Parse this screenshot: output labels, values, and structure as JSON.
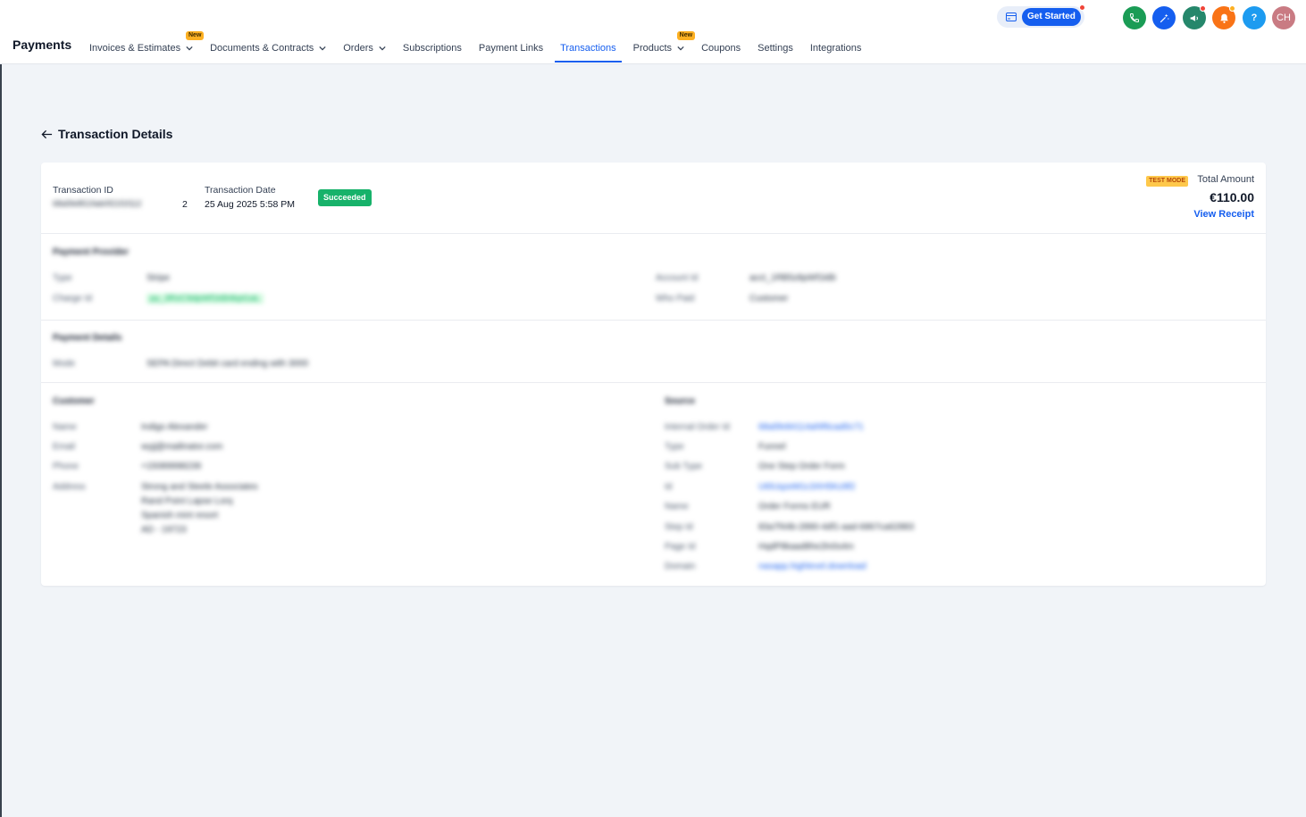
{
  "header": {
    "brand": "Payments",
    "nav": [
      {
        "label": "Invoices & Estimates",
        "dropdown": true,
        "badge": "New"
      },
      {
        "label": "Documents & Contracts",
        "dropdown": true
      },
      {
        "label": "Orders",
        "dropdown": true
      },
      {
        "label": "Subscriptions"
      },
      {
        "label": "Payment Links"
      },
      {
        "label": "Transactions",
        "active": true
      },
      {
        "label": "Products",
        "dropdown": true,
        "badge": "New"
      },
      {
        "label": "Coupons"
      },
      {
        "label": "Settings"
      },
      {
        "label": "Integrations"
      }
    ],
    "get_started": "Get Started",
    "help": "?",
    "avatar": "CH",
    "colors": {
      "accent": "#155eef",
      "phone": "#1a9c55",
      "magic": "#155eef",
      "megaphone": "#25876b",
      "bell": "#f97316",
      "help": "#1d9bf0",
      "avatar": "#c97b83"
    }
  },
  "page": {
    "title": "Transaction Details"
  },
  "transaction": {
    "id_label": "Transaction ID",
    "id_value": "68a5fe8519ab0f21f1f112",
    "id_last": "2",
    "date_label": "Transaction Date",
    "date_value": "25 Aug 2025 5:58 PM",
    "status": "Succeeded",
    "test_mode": "TEST MODE",
    "total_label": "Total Amount",
    "total_value": "€110.00",
    "view_receipt": "View Receipt"
  },
  "blurred": {
    "payment_provider": {
      "heading": "Payment Provider",
      "type_label": "Type",
      "type_value": "Stripe",
      "charge_label": "Charge Id",
      "charge_value": "py_3RzC9dpWf1kB4kpt1aL",
      "account_label": "Account Id",
      "account_value": "acct_1RB5z8pWf1kBi",
      "mode_label": "Who Paid",
      "mode_value": "Customer"
    },
    "payment_details": {
      "heading": "Payment Details",
      "mode_label": "Mode",
      "mode_value": "SEPA Direct Debit card ending with 3000"
    },
    "customer": {
      "heading": "Customer",
      "name_label": "Name",
      "name_value": "Indigo Alexander",
      "email_label": "Email",
      "email_value": "wyjj@mailinator.com",
      "phone_label": "Phone",
      "phone_value": "+15089998239",
      "address_label": "Address",
      "address_lines": [
        "Strong and Steele Associates",
        "Rand Point Lapse Lorq",
        "Spanish mint resort",
        "AD - 19723"
      ]
    },
    "source": {
      "heading": "Source",
      "internal_label": "Internal Order Id",
      "internal_value": "68a5fe84114af4f6cad0c71",
      "type_label": "Type",
      "type_value": "Funnel",
      "subtype_label": "Sub Type",
      "subtype_value": "One Step Order Form",
      "id_label": "Id",
      "id_value": "Ut0UqzeM1c3XH5Kz9f2",
      "name_label": "Name",
      "name_value": "Order Forms EUR",
      "step_label": "Step Id",
      "step_value": "83a7f44b-2890-4df1-aad-6867ca62883",
      "page_label": "Page Id",
      "page_value": "HqdP8kaad8he2ln0s4m",
      "domain_label": "Domain",
      "domain_value": "nasapp.highlevel.download"
    }
  }
}
